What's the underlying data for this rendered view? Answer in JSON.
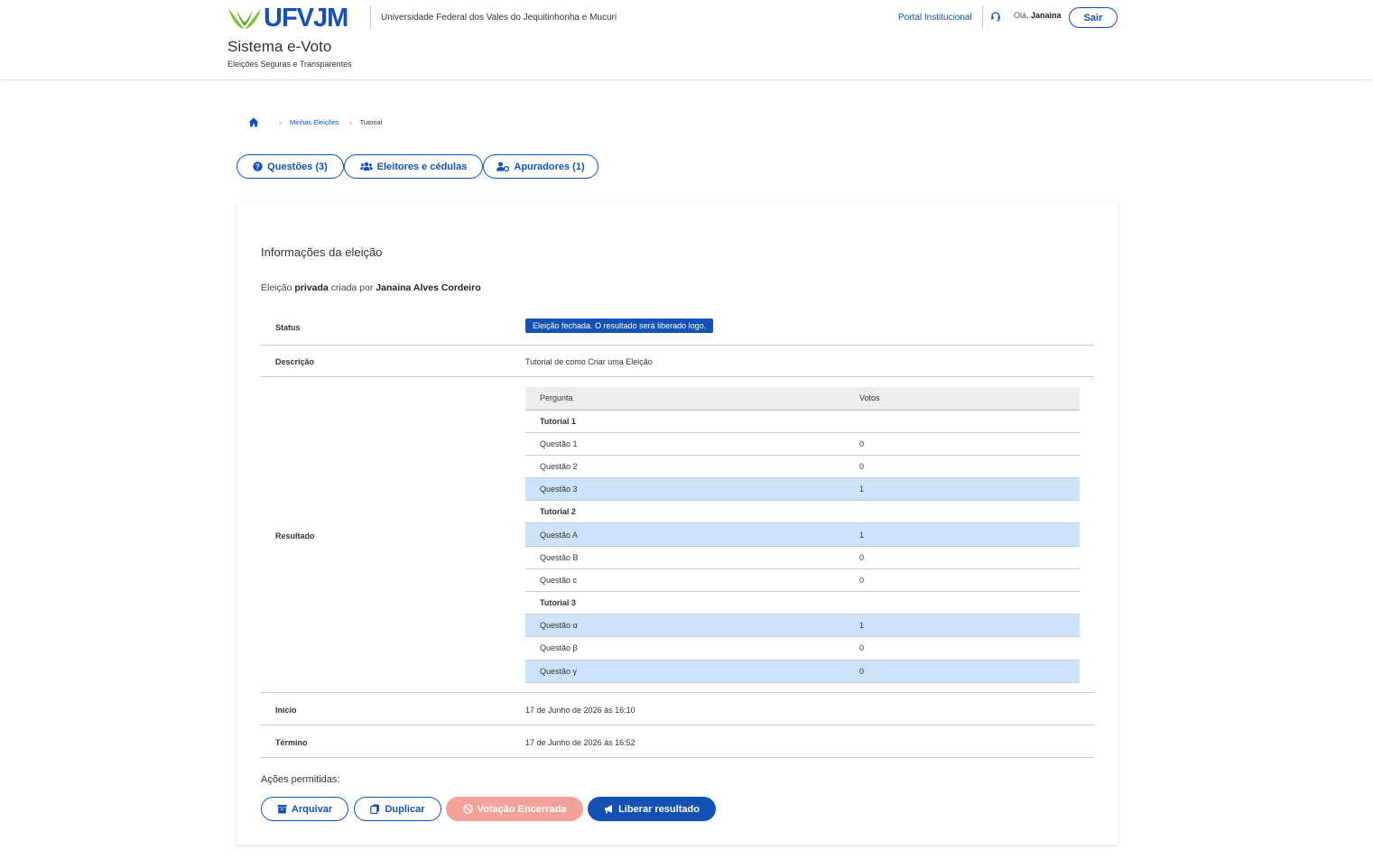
{
  "header": {
    "logo_text": "UFVJM",
    "university": "Universidade Federal dos Vales do Jequitinhonha e Mucuri",
    "system_title": "Sistema e-Voto",
    "system_subtitle": "Eleições Seguras e Transparentes",
    "portal_link": "Portal Institucional",
    "greeting_prefix": "Olá,",
    "user_name": "Janaina",
    "logout_label": "Sair"
  },
  "breadcrumb": {
    "items": [
      "Minhas Eleições",
      "Tutorial"
    ]
  },
  "tabs": [
    {
      "label": "Questões (3)",
      "icon": "question-circle-icon"
    },
    {
      "label": "Eleitores e cédulas",
      "icon": "users-icon"
    },
    {
      "label": "Apuradores (1)",
      "icon": "user-cog-icon"
    }
  ],
  "card": {
    "title": "Informações da eleição",
    "owner_prefix": "Eleição",
    "owner_type": "privada",
    "owner_mid": "criada por",
    "owner_name": "Janaina Alves Cordeiro",
    "status_label": "Status",
    "status_value": "Eleição fechada. O resultado será liberado logo.",
    "description_label": "Descrição",
    "description_value": "Tutorial de como Criar uma Eleição",
    "result_label": "Resultado",
    "start_label": "Início",
    "start_value": "17 de Junho de 2026 às 16:10",
    "end_label": "Término",
    "end_value": "17 de Junho de 2026 às 16:52",
    "actions_label": "Ações permitidas:"
  },
  "results": {
    "headers": [
      "Pergunta",
      "Votos"
    ],
    "rows": [
      {
        "type": "group",
        "label": "Tutorial 1",
        "votes": ""
      },
      {
        "type": "item",
        "label": "Questão 1",
        "votes": "0",
        "highlight": false
      },
      {
        "type": "item",
        "label": "Questão 2",
        "votes": "0",
        "highlight": false
      },
      {
        "type": "item",
        "label": "Questão 3",
        "votes": "1",
        "highlight": true
      },
      {
        "type": "group",
        "label": "Tutorial 2",
        "votes": ""
      },
      {
        "type": "item",
        "label": "Questão A",
        "votes": "1",
        "highlight": true
      },
      {
        "type": "item",
        "label": "Questão B",
        "votes": "0",
        "highlight": false
      },
      {
        "type": "item",
        "label": "Questão c",
        "votes": "0",
        "highlight": false
      },
      {
        "type": "group",
        "label": "Tutorial 3",
        "votes": ""
      },
      {
        "type": "item",
        "label": "Questão α",
        "votes": "1",
        "highlight": true
      },
      {
        "type": "item",
        "label": "Questão β",
        "votes": "0",
        "highlight": false
      },
      {
        "type": "item",
        "label": "Questão γ",
        "votes": "0",
        "highlight": true
      }
    ]
  },
  "actions": {
    "archive": "Arquivar",
    "duplicate": "Duplicar",
    "closed": "Votação Encerrada",
    "release": "Liberar resultado"
  },
  "colors": {
    "primary": "#1351b4",
    "highlight_row": "#cde3fb",
    "disabled_button": "#f4a19a",
    "logo_green": "#7bbf3e"
  }
}
